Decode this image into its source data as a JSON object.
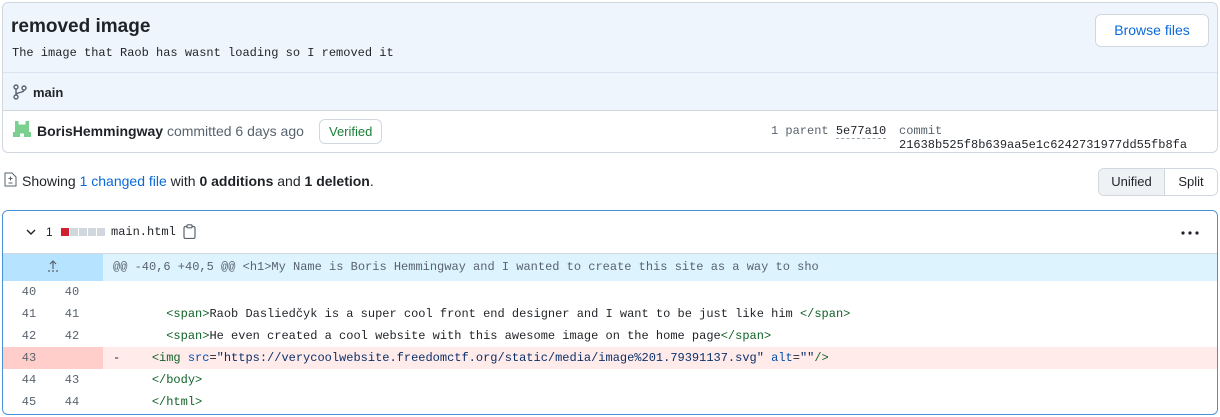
{
  "commit": {
    "title": "removed image",
    "description": "The image that Raob has wasnt loading so I removed it",
    "browse_label": "Browse files",
    "branch": "main",
    "author": "BorisHemmingway",
    "committed_text": "committed 6 days ago",
    "verified_label": "Verified",
    "parent_label": "1 parent",
    "parent_sha": "5e77a10",
    "commit_label": "commit",
    "commit_sha": "21638b525f8b639aa5e1c6242731977dd55fb8fa"
  },
  "summary": {
    "prefix": "Showing",
    "changed_files": "1 changed file",
    "with": "with",
    "additions": "0 additions",
    "and": "and",
    "deletions": "1 deletion",
    "period": "."
  },
  "view_toggle": {
    "unified": "Unified",
    "split": "Split"
  },
  "file": {
    "change_count": "1",
    "diffstat": [
      "del",
      "neutral",
      "neutral",
      "neutral",
      "neutral"
    ],
    "name": "main.html",
    "hunk_header": "@@ -40,6 +40,5 @@ <h1>My Name is Boris Hemmingway and I wanted to create this site as a way to sho",
    "lines": [
      {
        "type": "ctx",
        "old": "40",
        "new": "40",
        "sign": "",
        "indent": "",
        "tag_open": "",
        "text": "",
        "tag_close": ""
      },
      {
        "type": "ctx",
        "old": "41",
        "new": "41",
        "sign": "",
        "indent": "    ",
        "tag_open": "<span>",
        "text": "Raob Dasliedčyk is a super cool front end designer and I want to be just like him ",
        "tag_close": "</span>"
      },
      {
        "type": "ctx",
        "old": "42",
        "new": "42",
        "sign": "",
        "indent": "    ",
        "tag_open": "<span>",
        "text": "He even created a cool website with this awesome image on the home page",
        "tag_close": "</span>"
      },
      {
        "type": "del",
        "old": "43",
        "new": "",
        "sign": "-",
        "indent": "  ",
        "tag_open": "<img ",
        "attr1": "src",
        "eq1": "=",
        "val1": "\"https://verycoolwebsite.freedomctf.org/static/media/image%201.79391137.svg\"",
        "attr2": " alt",
        "eq2": "=",
        "val2": "\"\"",
        "tag_close": "/>"
      },
      {
        "type": "ctx",
        "old": "44",
        "new": "43",
        "sign": "",
        "indent": "  ",
        "tag_open": "</body>",
        "text": "",
        "tag_close": ""
      },
      {
        "type": "ctx",
        "old": "45",
        "new": "44",
        "sign": "",
        "indent": "  ",
        "tag_open": "</html>",
        "text": "",
        "tag_close": ""
      }
    ]
  },
  "colors": {
    "link": "#0969da",
    "verified": "#1a7f37",
    "deletion": "#cf222e",
    "hunk_bg": "#ddf4ff",
    "deleted_line_bg": "#ffebe9"
  },
  "icons": [
    "git-branch-icon",
    "identicon-avatar",
    "diff-file-icon",
    "chevron-down-icon",
    "copy-icon",
    "kebab-horizontal-icon",
    "unfold-icon"
  ]
}
